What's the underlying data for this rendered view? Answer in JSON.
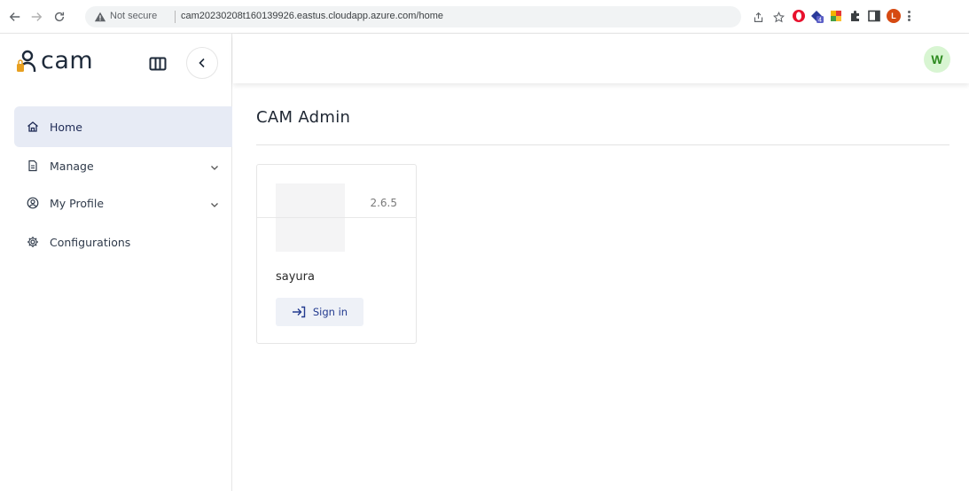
{
  "browser": {
    "security_label": "Not secure",
    "url": "cam20230208t160139926.eastus.cloudapp.azure.com/home",
    "profile_initial": "L"
  },
  "brand": {
    "name": "cam",
    "accent_color": "#e8a020",
    "primary_color": "#1e2a3a"
  },
  "sidebar": {
    "items": [
      {
        "label": "Home",
        "icon": "home-icon",
        "active": true
      },
      {
        "label": "Manage",
        "icon": "document-icon",
        "expandable": true
      },
      {
        "label": "My Profile",
        "icon": "user-circle-icon",
        "expandable": true
      },
      {
        "label": "Configurations",
        "icon": "gear-icon"
      }
    ]
  },
  "topbar": {
    "avatar_initial": "W",
    "avatar_color": "#d8f5d2"
  },
  "main": {
    "title": "CAM Admin",
    "cards": [
      {
        "name": "sayura",
        "version": "2.6.5",
        "action_label": "Sign in"
      }
    ]
  }
}
